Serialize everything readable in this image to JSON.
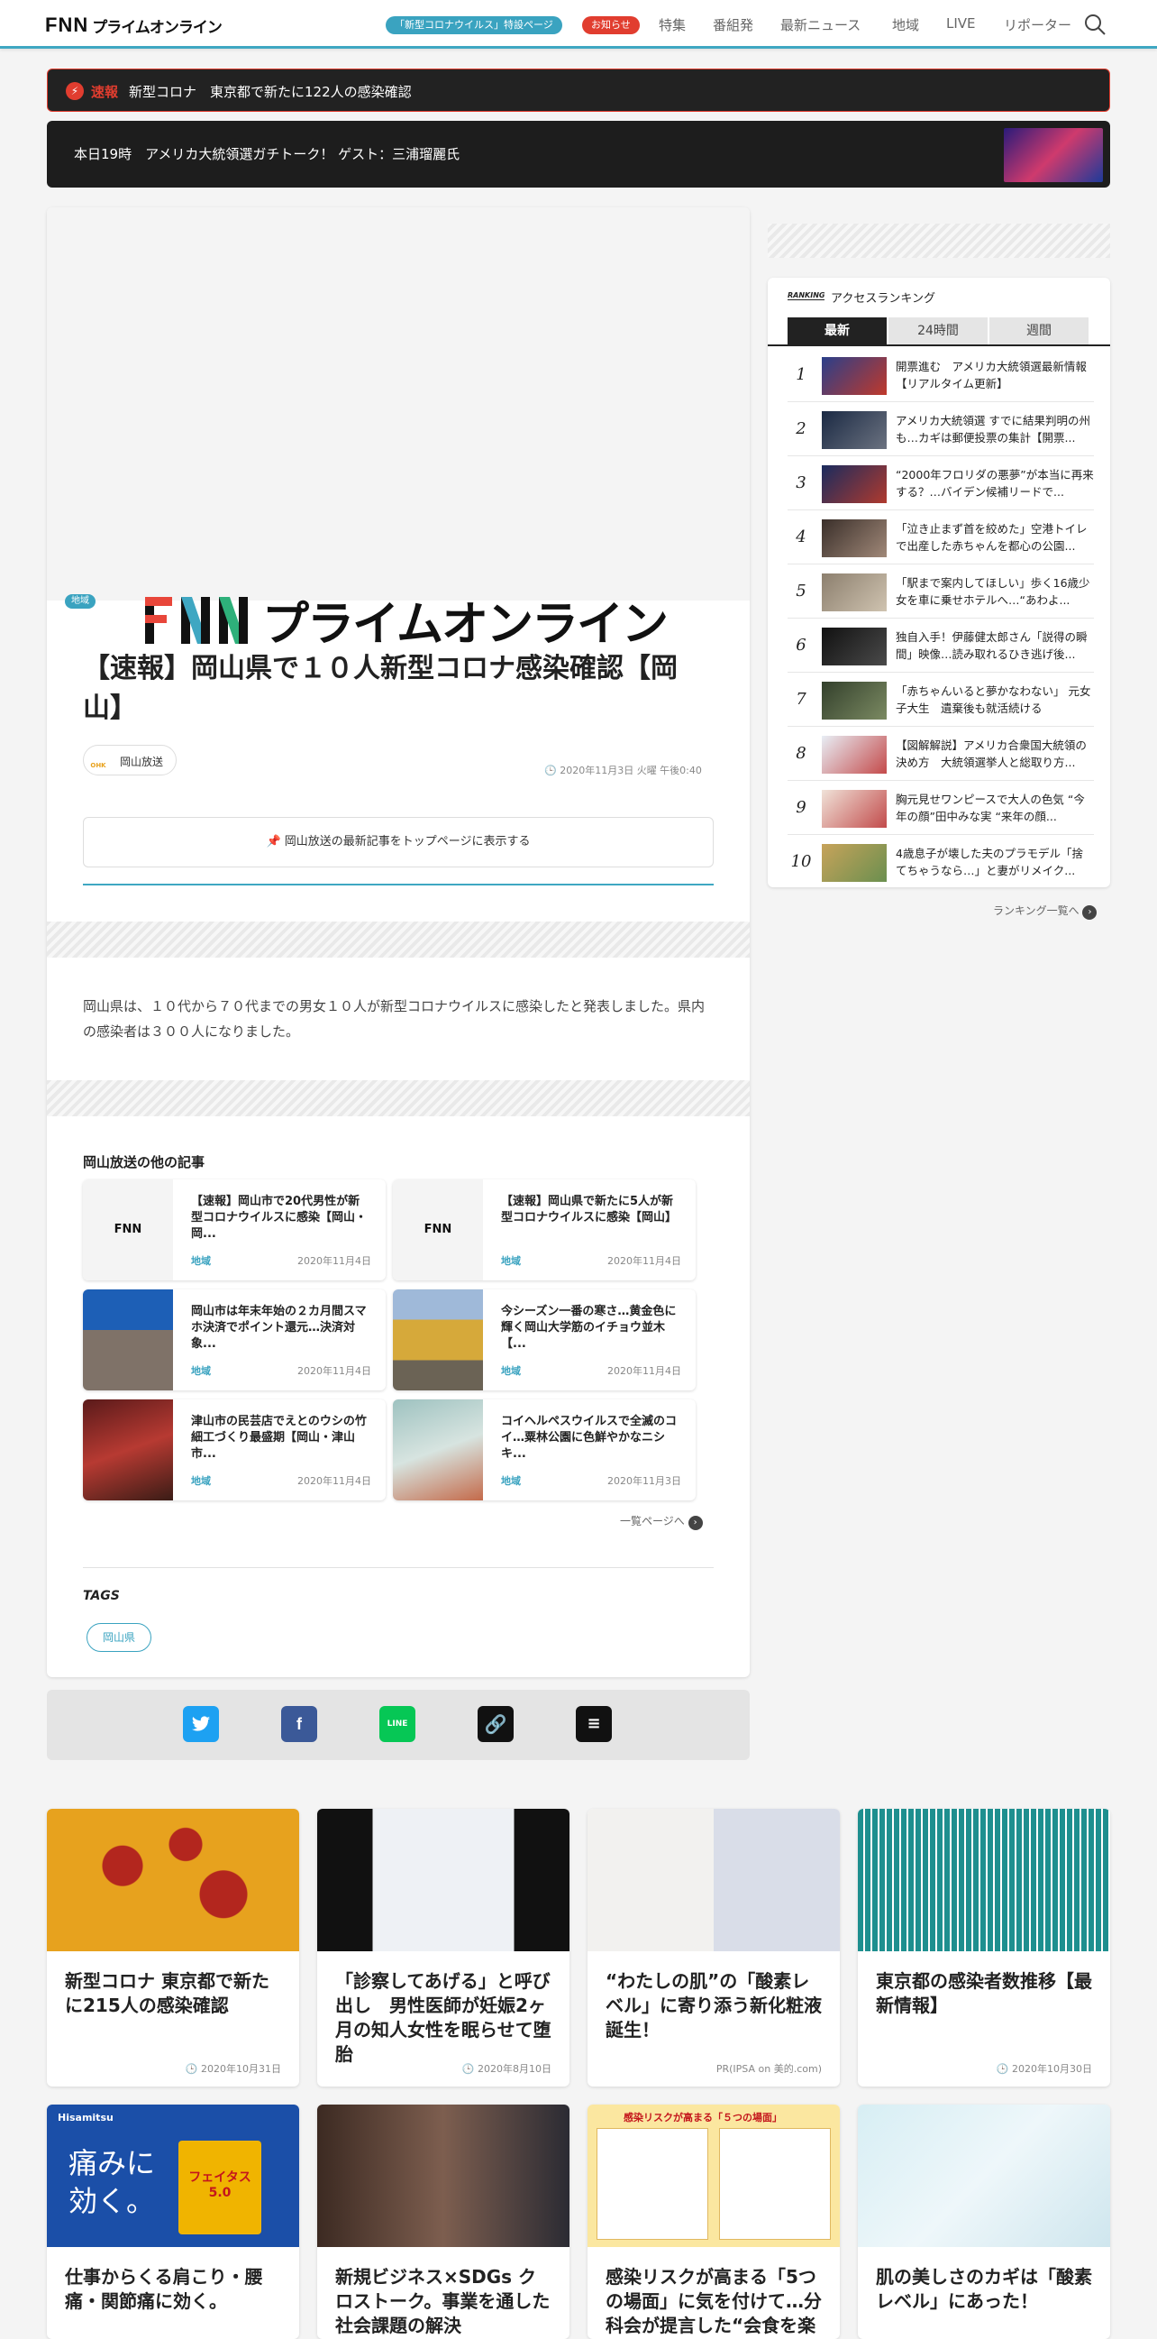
{
  "header": {
    "logo_mark": "FNN",
    "logo_text": "プライムオンライン",
    "pill_covid": "「新型コロナウイルス」特設ページ",
    "pill_notice": "お知らせ",
    "nav": [
      "特集",
      "番組発",
      "最新ニュース",
      "地域",
      "LIVE",
      "リポーター"
    ],
    "colors": {
      "accent": "#3fa7c2",
      "notice": "#e13d2f"
    }
  },
  "flash": {
    "icon": "lightning-icon",
    "label": "速報",
    "text": "新型コロナ　東京都で新たに122人の感染確認"
  },
  "live": {
    "text": "本日19時　アメリカ大統領選ガチトーク！ ゲスト：三浦瑠麗氏"
  },
  "article": {
    "category": "地域",
    "title": "【速報】岡山県で１０人新型コロナ感染確認【岡山】",
    "source": "岡山放送",
    "source_logo": "OHK",
    "date": "2020年11月3日 火曜 午後0:40",
    "follow_label": "岡山放送の最新記事をトップページに表示する",
    "body": "岡山県は、１０代から７０代までの男女１０人が新型コロナウイルスに感染したと発表しました。県内の感染者は３００人になりました。",
    "other_heading": "岡山放送の他の記事",
    "other": [
      {
        "title": "【速報】岡山市で20代男性が新型コロナウイルスに感染【岡山・岡...",
        "cat": "地域",
        "date": "2020年11月4日"
      },
      {
        "title": "【速報】岡山県で新たに5人が新型コロナウイルスに感染【岡山】",
        "cat": "地域",
        "date": "2020年11月4日"
      },
      {
        "title": "岡山市は年末年始の２カ月間スマホ決済でポイント還元…決済対象...",
        "cat": "地域",
        "date": "2020年11月4日"
      },
      {
        "title": "今シーズン一番の寒さ…黄金色に輝く岡山大学筋のイチョウ並木【...",
        "cat": "地域",
        "date": "2020年11月4日"
      },
      {
        "title": "津山市の民芸店でえとのウシの竹細工づくり最盛期【岡山・津山市...",
        "cat": "地域",
        "date": "2020年11月4日"
      },
      {
        "title": "コイヘルペスウイルスで全滅のコイ…粟林公園に色鮮やかなニシキ...",
        "cat": "地域",
        "date": "2020年11月3日"
      }
    ],
    "more_label": "一覧ページへ",
    "tags_heading": "TAGS",
    "tags": [
      "岡山県"
    ]
  },
  "share": {
    "icons": [
      "twitter-icon",
      "facebook-icon",
      "line-icon",
      "link-icon",
      "comment-icon"
    ],
    "line_text": "LINE"
  },
  "ranking": {
    "badge": "RANKING",
    "title": "アクセスランキング",
    "tabs": [
      "最新",
      "24時間",
      "週間"
    ],
    "items": [
      {
        "n": "1",
        "text": "開票進む　アメリカ大統領選最新情報【リアルタイム更新】"
      },
      {
        "n": "2",
        "text": "アメリカ大統領選 すでに結果判明の州も…カギは郵便投票の集計【開票..."
      },
      {
        "n": "3",
        "text": "“2000年フロリダの悪夢”が本当に再来する？…バイデン候補リードで..."
      },
      {
        "n": "4",
        "text": "「泣き止まず首を絞めた」空港トイレで出産した赤ちゃんを都心の公園..."
      },
      {
        "n": "5",
        "text": "「駅まで案内してほしい」歩く16歳少女を車に乗せホテルへ…“あわよ..."
      },
      {
        "n": "6",
        "text": "独自入手！伊藤健太郎さん「説得の瞬間」映像…読み取れるひき逃げ後..."
      },
      {
        "n": "7",
        "text": "「赤ちゃんいると夢かなわない」 元女子大生　遺棄後も就活続ける"
      },
      {
        "n": "8",
        "text": "【図解解説】アメリカ合衆国大統領の決め方　大統領選挙人と総取り方..."
      },
      {
        "n": "9",
        "text": "胸元見せワンピースで大人の色気 “今年の顔”田中みな実 “来年の顔..."
      },
      {
        "n": "10",
        "text": "4歳息子が壊した夫のプラモデル「捨てちゃうなら…」と妻がリメイク..."
      }
    ],
    "more_label": "ランキング一覧へ"
  },
  "bottom_cards": [
    {
      "title": "新型コロナ 東京都で新たに215人の感染確認",
      "date": "2020年10月31日"
    },
    {
      "title": "「診察してあげる」と呼び出し　男性医師が妊娠2ヶ月の知人女性を眠らせて堕胎",
      "date": "2020年8月10日"
    },
    {
      "title": "“わたしの肌”の「酸素レベル」に寄り添う新化粧液誕生！",
      "date": "PR(IPSA on 美的.com)"
    },
    {
      "title": "東京都の感染者数推移【最新情報】",
      "date": "2020年10月30日"
    },
    {
      "title": "仕事からくる肩こり・腰痛・関節痛に効く。",
      "date": ""
    },
    {
      "title": "新規ビジネス×SDGs クロストーク。事業を通した社会課題の解決",
      "date": ""
    },
    {
      "title": "感染リスクが高まる「5つの場面」に気を付けて…分科会が提言した“会食を楽",
      "date": ""
    },
    {
      "title": "肌の美しさのカギは「酸素レベル」にあった！",
      "date": ""
    }
  ],
  "ad_text": {
    "hisamitsu": "Hisamitsu",
    "ad_headline": "痛みに効く。",
    "product": "フェイタス5.0",
    "infographic_title": "感染リスクが高まる「５つの場面」"
  }
}
